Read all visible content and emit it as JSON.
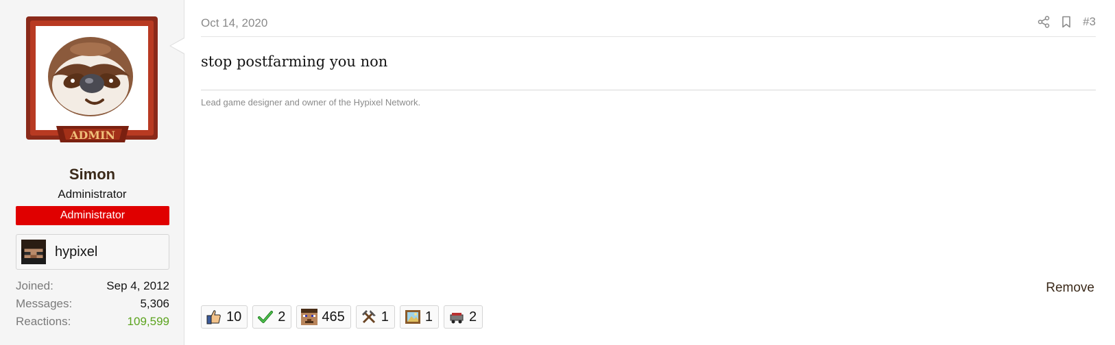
{
  "post": {
    "date": "Oct 14, 2020",
    "number": "#3",
    "message": "stop postfarming you non",
    "signature": "Lead game designer and owner of the Hypixel Network.",
    "remove_label": "Remove"
  },
  "user": {
    "name": "Simon",
    "title": "Administrator",
    "banner": "Administrator",
    "avatar_frame_text": "ADMIN",
    "ign": "hypixel",
    "stats": [
      {
        "key": "Joined:",
        "value": "Sep 4, 2012"
      },
      {
        "key": "Messages:",
        "value": "5,306"
      },
      {
        "key": "Reactions:",
        "value": "109,599"
      }
    ]
  },
  "reactions": [
    {
      "icon": "thumbs-up-icon",
      "count": "10"
    },
    {
      "icon": "checkmark-icon",
      "count": "2"
    },
    {
      "icon": "minecraft-face-icon",
      "count": "465"
    },
    {
      "icon": "crossed-tools-icon",
      "count": "1"
    },
    {
      "icon": "painting-icon",
      "count": "1"
    },
    {
      "icon": "minecart-icon",
      "count": "2"
    }
  ],
  "colors": {
    "banner": "#e00000",
    "username": "#3b2a1a",
    "reactions_stat": "#5ba31e"
  }
}
